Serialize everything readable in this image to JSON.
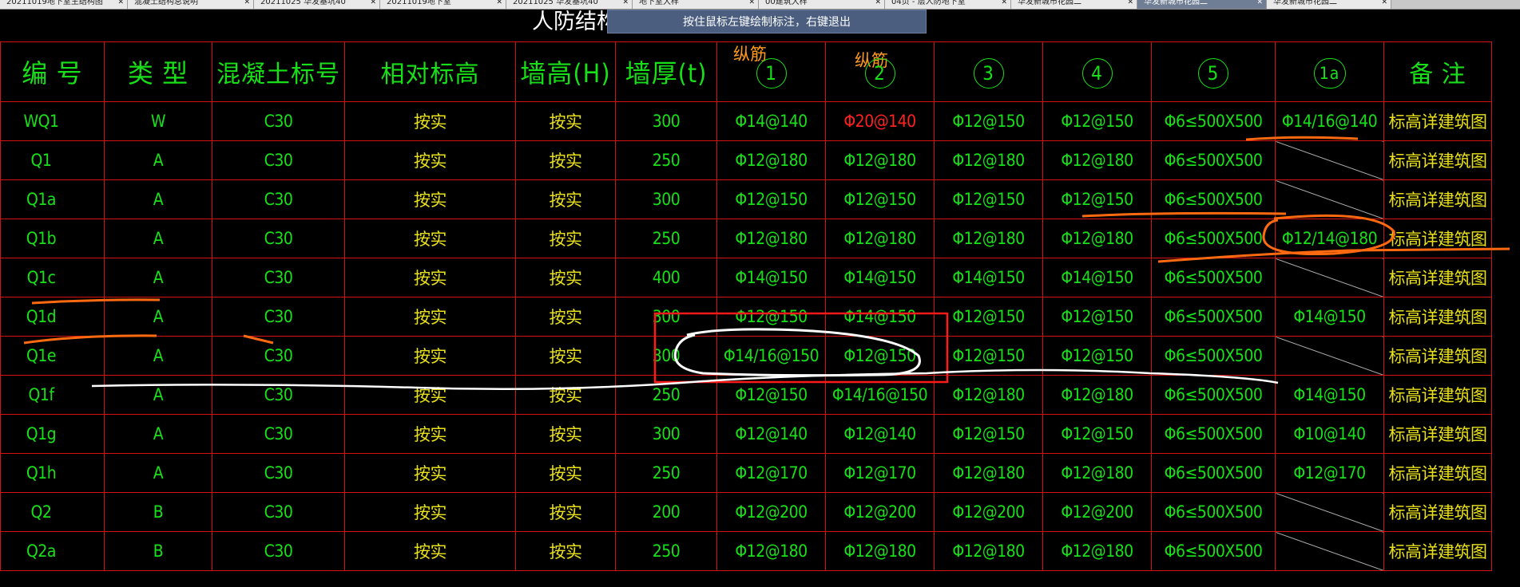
{
  "tabs": [
    {
      "label": "20211019地下室主结构图"
    },
    {
      "label": "混凝土结构总说明"
    },
    {
      "label": "20211025 华发基坑40"
    },
    {
      "label": "20211019地下室"
    },
    {
      "label": "20211025 华发基坑40"
    },
    {
      "label": "地下室大样"
    },
    {
      "label": "00建筑大样"
    },
    {
      "label": "04页 - 层人防地下室"
    },
    {
      "label": "华发新城市花园二"
    },
    {
      "label": "华发新城市花园二"
    },
    {
      "label": "华发新城市花园二"
    }
  ],
  "title": "人防结构墙",
  "tooltip": "按住鼠标左键绘制标注，右键退出",
  "rebar_labels": [
    "纵筋",
    "纵筋"
  ],
  "headers": [
    "编 号",
    "类 型",
    "混凝土标号",
    "相对标高",
    "墙高(H)",
    "墙厚(t)",
    "1",
    "2",
    "3",
    "4",
    "5",
    "1a",
    "备  注"
  ],
  "rows": [
    {
      "id": "WQ1",
      "type": "W",
      "grade": "C30",
      "elev": "按实",
      "height": "按实",
      "thick": "300",
      "c1": "Φ14@140",
      "c2": "Φ20@140",
      "c3": "Φ12@150",
      "c4": "Φ12@150",
      "c5": "Φ6≤500X500",
      "c1a": "Φ14/16@140",
      "note": "标高详建筑图"
    },
    {
      "id": "Q1",
      "type": "A",
      "grade": "C30",
      "elev": "按实",
      "height": "按实",
      "thick": "250",
      "c1": "Φ12@180",
      "c2": "Φ12@180",
      "c3": "Φ12@180",
      "c4": "Φ12@180",
      "c5": "Φ6≤500X500",
      "c1a": "",
      "note": "标高详建筑图"
    },
    {
      "id": "Q1a",
      "type": "A",
      "grade": "C30",
      "elev": "按实",
      "height": "按实",
      "thick": "300",
      "c1": "Φ12@150",
      "c2": "Φ12@150",
      "c3": "Φ12@150",
      "c4": "Φ12@150",
      "c5": "Φ6≤500X500",
      "c1a": "",
      "note": "标高详建筑图"
    },
    {
      "id": "Q1b",
      "type": "A",
      "grade": "C30",
      "elev": "按实",
      "height": "按实",
      "thick": "250",
      "c1": "Φ12@180",
      "c2": "Φ12@180",
      "c3": "Φ12@180",
      "c4": "Φ12@180",
      "c5": "Φ6≤500X500",
      "c1a": "Φ12/14@180",
      "note": "标高详建筑图"
    },
    {
      "id": "Q1c",
      "type": "A",
      "grade": "C30",
      "elev": "按实",
      "height": "按实",
      "thick": "400",
      "c1": "Φ14@150",
      "c2": "Φ14@150",
      "c3": "Φ14@150",
      "c4": "Φ14@150",
      "c5": "Φ6≤500X500",
      "c1a": "",
      "note": "标高详建筑图"
    },
    {
      "id": "Q1d",
      "type": "A",
      "grade": "C30",
      "elev": "按实",
      "height": "按实",
      "thick": "300",
      "c1": "Φ12@150",
      "c2": "Φ14@150",
      "c3": "Φ12@150",
      "c4": "Φ12@150",
      "c5": "Φ6≤500X500",
      "c1a": "Φ14@150",
      "note": "标高详建筑图"
    },
    {
      "id": "Q1e",
      "type": "A",
      "grade": "C30",
      "elev": "按实",
      "height": "按实",
      "thick": "300",
      "c1": "Φ14/16@150",
      "c2": "Φ12@150",
      "c3": "Φ12@150",
      "c4": "Φ12@150",
      "c5": "Φ6≤500X500",
      "c1a": "",
      "note": "标高详建筑图"
    },
    {
      "id": "Q1f",
      "type": "A",
      "grade": "C30",
      "elev": "按实",
      "height": "按实",
      "thick": "250",
      "c1": "Φ12@150",
      "c2": "Φ14/16@150",
      "c3": "Φ12@180",
      "c4": "Φ12@180",
      "c5": "Φ6≤500X500",
      "c1a": "Φ14@150",
      "note": "标高详建筑图"
    },
    {
      "id": "Q1g",
      "type": "A",
      "grade": "C30",
      "elev": "按实",
      "height": "按实",
      "thick": "300",
      "c1": "Φ12@140",
      "c2": "Φ12@140",
      "c3": "Φ12@150",
      "c4": "Φ12@150",
      "c5": "Φ6≤500X500",
      "c1a": "Φ10@140",
      "note": "标高详建筑图"
    },
    {
      "id": "Q1h",
      "type": "A",
      "grade": "C30",
      "elev": "按实",
      "height": "按实",
      "thick": "250",
      "c1": "Φ12@170",
      "c2": "Φ12@170",
      "c3": "Φ12@180",
      "c4": "Φ12@180",
      "c5": "Φ6≤500X500",
      "c1a": "Φ12@170",
      "note": "标高详建筑图"
    },
    {
      "id": "Q2",
      "type": "B",
      "grade": "C30",
      "elev": "按实",
      "height": "按实",
      "thick": "200",
      "c1": "Φ12@200",
      "c2": "Φ12@200",
      "c3": "Φ12@200",
      "c4": "Φ12@200",
      "c5": "Φ6≤500X500",
      "c1a": "",
      "note": "标高详建筑图"
    },
    {
      "id": "Q2a",
      "type": "B",
      "grade": "C30",
      "elev": "按实",
      "height": "按实",
      "thick": "250",
      "c1": "Φ12@180",
      "c2": "Φ12@180",
      "c3": "Φ12@180",
      "c4": "Φ12@180",
      "c5": "Φ6≤500X500",
      "c1a": "",
      "note": "标高详建筑图"
    }
  ],
  "colors": {
    "background": "#000000",
    "grid": "#d31212",
    "text": "#18e018",
    "note_text": "#e8e01a",
    "highlight": "#ff2020",
    "rebar_label": "#ff9a1a",
    "markup_orange": "#ff6a10",
    "markup_white": "#ffffff",
    "markup_box": "#ff1a1a"
  }
}
